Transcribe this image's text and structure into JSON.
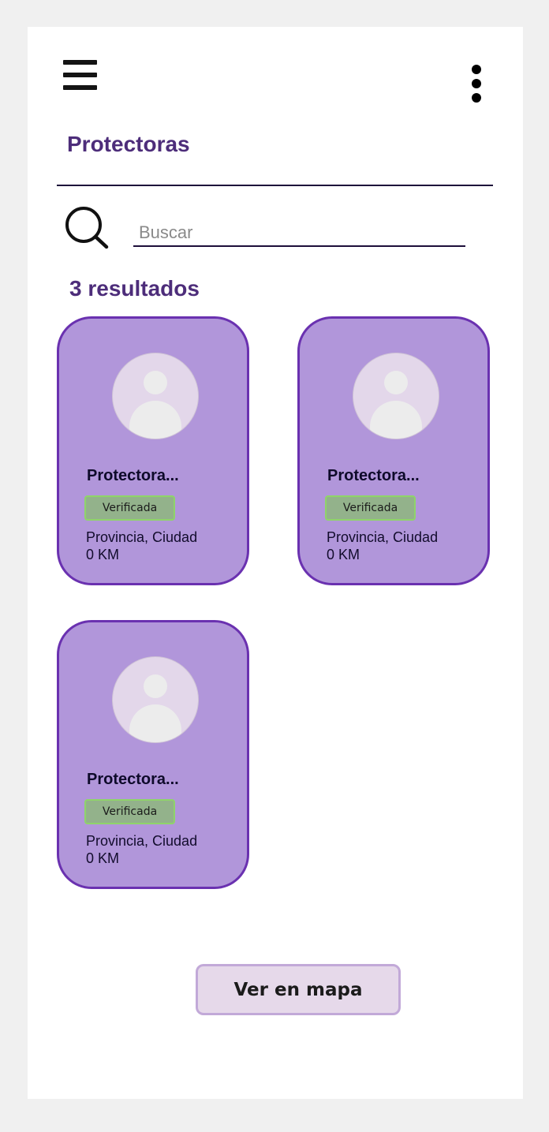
{
  "header": {
    "menu_icon": "hamburger-menu-icon",
    "more_icon": "kebab-more-icon",
    "title": "Protectoras"
  },
  "search": {
    "icon": "search-icon",
    "placeholder": "Buscar",
    "value": ""
  },
  "results_label": "3 resultados",
  "cards": [
    {
      "name": "Protectora...",
      "badge": "Verificada",
      "location": "Provincia, Ciudad",
      "distance": "0 KM",
      "avatar_icon": "user-avatar-icon"
    },
    {
      "name": "Protectora...",
      "badge": "Verificada",
      "location": "Provincia, Ciudad",
      "distance": "0 KM",
      "avatar_icon": "user-avatar-icon"
    },
    {
      "name": "Protectora...",
      "badge": "Verificada",
      "location": "Provincia, Ciudad",
      "distance": "0 KM",
      "avatar_icon": "user-avatar-icon"
    }
  ],
  "map_button": {
    "label": "Ver en mapa"
  },
  "colors": {
    "accent_purple": "#4d2d7a",
    "card_bg": "#b196da",
    "card_border": "#6a31b0",
    "badge_bg": "#93b28b",
    "badge_border": "#8fd46a",
    "button_bg": "#e6d9ea"
  }
}
